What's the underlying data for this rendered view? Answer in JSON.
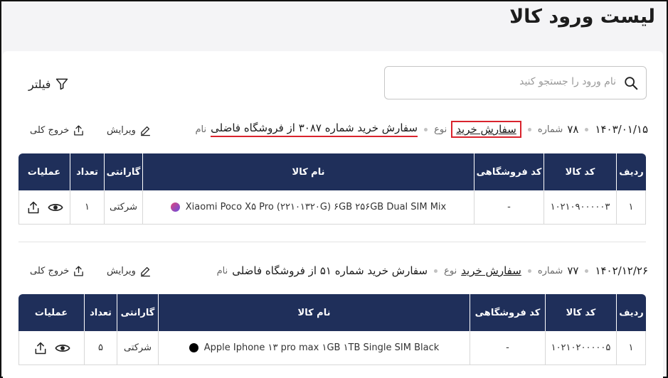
{
  "page": {
    "title": "لیست ورود کالا"
  },
  "search": {
    "placeholder": "نام ورود را جستجو کنید",
    "icon": "search-icon"
  },
  "filter": {
    "label": "فیلتر",
    "icon": "filter-icon"
  },
  "labels": {
    "name": "نام",
    "type": "نوع",
    "number": "شماره",
    "edit": "ویرایش",
    "export": "خروج کلی"
  },
  "table_headers": [
    "ردیف",
    "کد کالا",
    "کد فروشگاهی",
    "نام کالا",
    "گارانتی",
    "تعداد",
    "عملیات"
  ],
  "orders": [
    {
      "name": "سفارش خرید شماره ۳۰۸۷ از فروشگاه فاضلی",
      "type": "سفارش خرید",
      "number": "۷۸",
      "date": "۱۴۰۳/۰۱/۱۵",
      "rows": [
        {
          "index": "۱",
          "code": "۱۰۲۱۰۹۰۰۰۰۰۳",
          "store_code": "-",
          "product": "Xiaomi Poco X۵ Pro (۲۲۱۰۱۳۲۰G) ۶GB ۲۵۶GB Dual SIM Mix",
          "swatch": "#9b4fd6",
          "warranty": "شرکتی",
          "qty": "۱"
        }
      ]
    },
    {
      "name": "سفارش خرید شماره ۵۱ از فروشگاه فاضلی",
      "type": "سفارش خرید",
      "number": "۷۷",
      "date": "۱۴۰۲/۱۲/۲۶",
      "rows": [
        {
          "index": "۱",
          "code": "۱۰۲۱۰۲۰۰۰۰۰۵",
          "store_code": "-",
          "product": "Apple Iphone ۱۳ pro max ۱GB ۱TB Single SIM Black",
          "swatch": "#000000",
          "warranty": "شرکتی",
          "qty": "۵"
        }
      ]
    }
  ],
  "colors": {
    "header_bg": "#1f2f5a",
    "highlight": "#d9232d"
  }
}
